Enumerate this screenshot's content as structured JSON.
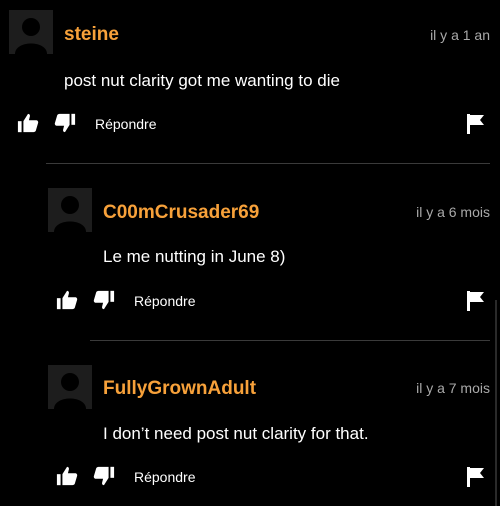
{
  "comments": [
    {
      "username": "steine",
      "time": "il y a 1 an",
      "text": "post nut clarity got me wanting to die",
      "reply_label": "Répondre"
    },
    {
      "username": "C00mCrusader69",
      "time": "il y a 6 mois",
      "text": "Le me nutting in June 8)",
      "reply_label": "Répondre"
    },
    {
      "username": "FullyGrownAdult",
      "time": "il y a 7 mois",
      "text": "I don’t need post nut clarity for that.",
      "reply_label": "Répondre"
    }
  ],
  "icons": {
    "like": "thumbs-up-icon",
    "dislike": "thumbs-down-icon",
    "flag": "flag-icon",
    "avatar": "default-avatar"
  },
  "colors": {
    "background": "#000000",
    "username": "#f7a13a",
    "text": "#ffffff",
    "time": "#a9a9a9",
    "divider": "#3a3a3a"
  }
}
